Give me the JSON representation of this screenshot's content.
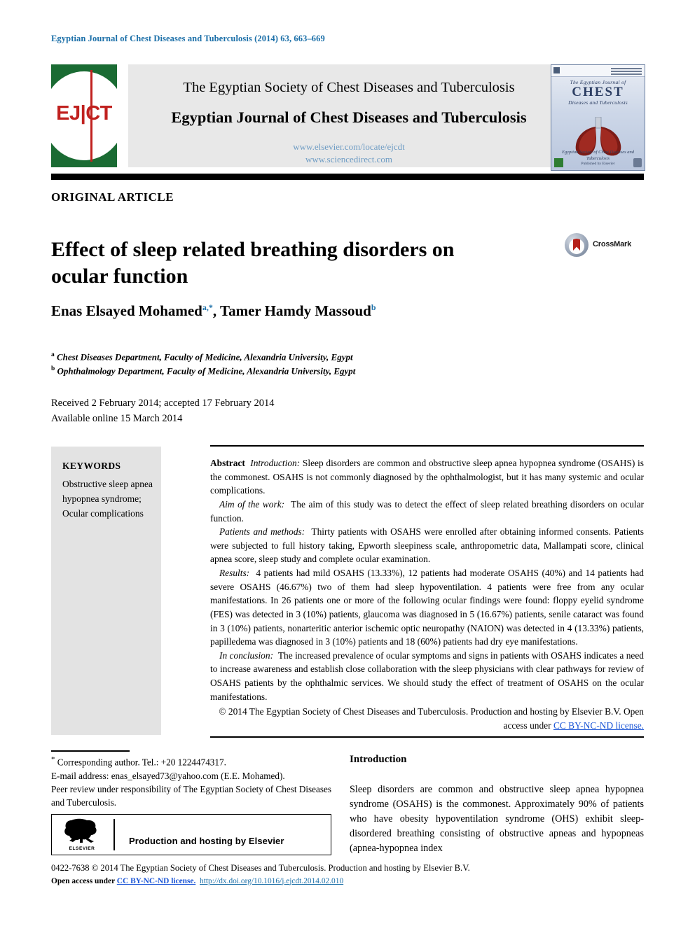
{
  "running_head": "Egyptian Journal of Chest Diseases and Tuberculosis (2014) 63, 663–669",
  "journal_header": {
    "logo_text": "EJ|CT",
    "society_line": "The Egyptian Society of Chest Diseases and Tuberculosis",
    "journal_line": "Egyptian Journal of Chest Diseases and Tuberculosis",
    "url_elsevier": "www.elsevier.com/locate/ejcdt",
    "url_sciencedirect": "www.sciencedirect.com",
    "cover": {
      "line1": "The Egyptian Journal of",
      "line2": "CHEST",
      "line3": "Diseases and Tuberculosis",
      "foot1": "Egyptian Society of Chest Diseases and Tuberculosis",
      "foot2": "Published by Elsevier"
    }
  },
  "article_type": "ORIGINAL ARTICLE",
  "title": "Effect of sleep related breathing disorders on ocular function",
  "crossmark_label": "CrossMark",
  "authors": {
    "author1": "Enas Elsayed Mohamed",
    "author1_sup": "a,*",
    "separator": ", ",
    "author2": "Tamer Hamdy Massoud",
    "author2_sup": "b"
  },
  "affiliations": [
    {
      "sup": "a",
      "text": "Chest Diseases Department, Faculty of Medicine, Alexandria University, Egypt"
    },
    {
      "sup": "b",
      "text": "Ophthalmology Department, Faculty of Medicine, Alexandria University, Egypt"
    }
  ],
  "dates": {
    "line1": "Received 2 February 2014; accepted 17 February 2014",
    "line2": "Available online 15 March 2014"
  },
  "keywords": {
    "heading": "KEYWORDS",
    "items": "Obstructive sleep apnea hypopnea syndrome; Ocular complications"
  },
  "abstract": {
    "abstract_label": "Abstract",
    "intro_label": "Introduction:",
    "intro_text": "Sleep disorders are common and obstructive sleep apnea hypopnea syndrome (OSAHS) is the commonest. OSAHS is not commonly diagnosed by the ophthalmologist, but it has many systemic and ocular complications.",
    "aim_label": "Aim of the work:",
    "aim_text": "The aim of this study was to detect the effect of sleep related breathing disorders on ocular function.",
    "methods_label": "Patients and methods:",
    "methods_text": "Thirty patients with OSAHS were enrolled after obtaining informed consents. Patients were subjected to full history taking, Epworth sleepiness scale, anthropometric data, Mallampati score, clinical apnea score, sleep study and complete ocular examination.",
    "results_label": "Results:",
    "results_text": "4 patients had mild OSAHS (13.33%), 12 patients had moderate OSAHS (40%) and 14 patients had severe OSAHS (46.67%) two of them had sleep hypoventilation. 4 patients were free from any ocular manifestations. In 26 patients one or more of the following ocular findings were found: floppy eyelid syndrome (FES) was detected in 3 (10%) patients, glaucoma was diagnosed in 5 (16.67%) patients, senile cataract was found in 3 (10%) patients, nonarteritic anterior ischemic optic neuropathy (NAION) was detected in 4 (13.33%) patients, papilledema was diagnosed in 3 (10%) patients and 18 (60%) patients had dry eye manifestations.",
    "conclusion_label": "In conclusion:",
    "conclusion_text": "The increased prevalence of ocular symptoms and signs in patients with OSAHS indicates a need to increase awareness and establish close collaboration with the sleep physicians with clear pathways for review of OSAHS patients by the ophthalmic services. We should study the effect of treatment of OSAHS on the ocular manifestations.",
    "copyright_text": "© 2014 The Egyptian Society of Chest Diseases and Tuberculosis. Production and hosting by Elsevier B.V.  Open access under ",
    "copyright_license": "CC BY-NC-ND license."
  },
  "footnotes": {
    "corresponding": "Corresponding author. Tel.: +20 1224474317.",
    "corresponding_sup": "*",
    "email_label": "E-mail address:",
    "email": "enas_elsayed73@yahoo.com",
    "email_suffix": "(E.E. Mohamed).",
    "peer_review": "Peer review under responsibility of The Egyptian Society of Chest Diseases and Tuberculosis."
  },
  "elsevier_box": {
    "wordmark": "ELSEVIER",
    "text": "Production and hosting by Elsevier"
  },
  "introduction": {
    "heading": "Introduction",
    "body": "Sleep disorders are common and obstructive sleep apnea hypopnea syndrome (OSAHS) is the commonest. Approximately 90% of patients who have obesity hypoventilation syndrome (OHS) exhibit sleep-disordered breathing consisting of obstructive apneas and hypopneas (apnea-hypopnea index"
  },
  "bottom": {
    "line1": "0422-7638 © 2014 The Egyptian Society of Chest Diseases and Tuberculosis. Production and hosting by Elsevier B.V.",
    "line2_pre": "Open access under ",
    "line2_license": "CC BY-NC-ND license.",
    "line2_doi": "http://dx.doi.org/10.1016/j.ejcdt.2014.02.010"
  },
  "colors": {
    "running_head": "#1b6fa8",
    "logo_green": "#1a6b33",
    "logo_red": "#c0211f",
    "link_blue": "#1b55d6",
    "url_blue": "#6e9cc4",
    "header_band": "#e8e8e8",
    "keyword_bg": "#e3e3e3"
  }
}
